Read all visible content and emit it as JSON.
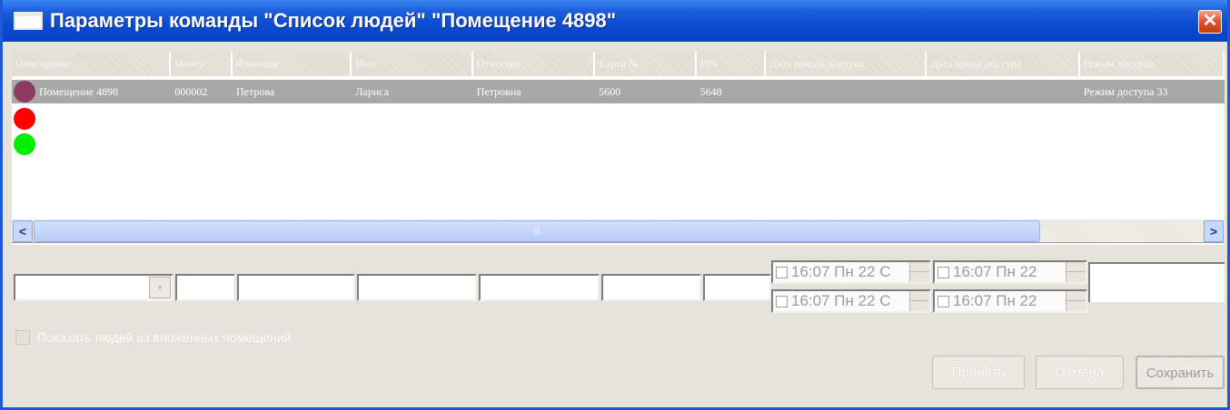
{
  "window": {
    "title": "Параметры команды \"Список людей\" \"Помещение 4898\"",
    "close_label": "✕"
  },
  "grid": {
    "columns": [
      "Помещение",
      "Номер",
      "Фамилия",
      "Имя",
      "Отчество",
      "Карта №",
      "PIN",
      "Дата начала доступа",
      "Дата конца доступа",
      "Режим доступа"
    ],
    "rows": [
      {
        "cells": [
          "Помещение 4898",
          "000002",
          "Петрова",
          "Лариса",
          "Петровна",
          "5600",
          "5648",
          "",
          "",
          "Режим доступа 33"
        ]
      }
    ],
    "status_colors": [
      "#8b3a62",
      "#ff0000",
      "#00ee00"
    ]
  },
  "scrollbar": {
    "left_arrow": "<",
    "right_arrow": ">",
    "thumb_grip": "|||"
  },
  "filters": {
    "combo_arrow": "▾",
    "date_pickers": [
      "16:07  Пн 22 С",
      "16:07  Пн 22",
      "16:07  Пн 22 С",
      "16:07  Пн 22"
    ]
  },
  "options": {
    "checkbox_label": "Показать людей из вложенных помещений"
  },
  "buttons": {
    "apply": "Принять",
    "cancel": "Отмена",
    "save": "Сохранить"
  }
}
